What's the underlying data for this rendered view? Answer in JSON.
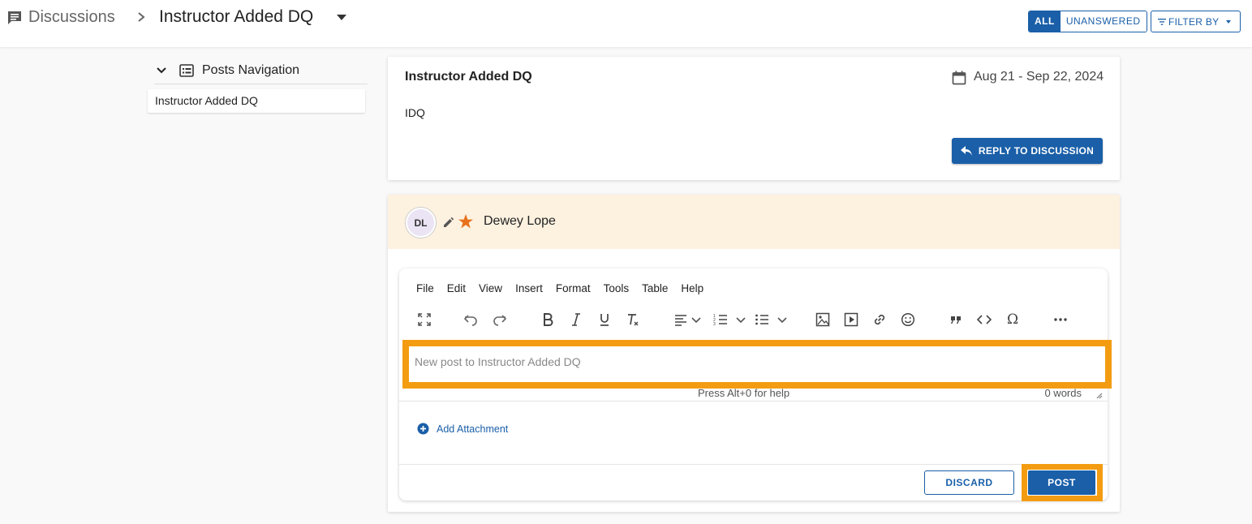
{
  "colors": {
    "primary": "#1a5fa8",
    "highlight": "#f39c12",
    "author_header_bg": "#fdf1e0",
    "star": "#e8711b"
  },
  "header": {
    "icon": "chat-bubble-icon",
    "root_label": "Discussions",
    "current_label": "Instructor Added DQ",
    "filter_all": "ALL",
    "filter_unanswered": "UNANSWERED",
    "filter_by": "FILTER BY"
  },
  "nav": {
    "title": "Posts Navigation",
    "items": [
      {
        "label": "Instructor Added DQ"
      }
    ]
  },
  "topic": {
    "title": "Instructor Added DQ",
    "dates": "Aug 21 - Sep 22, 2024",
    "body": "IDQ",
    "reply_label": "REPLY TO DISCUSSION"
  },
  "reply": {
    "initials": "DL",
    "author": "Dewey Lope",
    "editor": {
      "menu": [
        "File",
        "Edit",
        "View",
        "Insert",
        "Format",
        "Tools",
        "Table",
        "Help"
      ],
      "placeholder": "New post to Instructor Added DQ",
      "help_hint": "Press Alt+0 for help",
      "word_count": "0 words",
      "toolbar_icons": [
        "fullscreen-icon",
        "undo-icon",
        "redo-icon",
        "bold-icon",
        "italic-icon",
        "underline-icon",
        "clear-format-icon",
        "align-icon",
        "numbered-list-icon",
        "bullet-list-icon",
        "image-icon",
        "media-icon",
        "link-icon",
        "emoji-icon",
        "blockquote-icon",
        "code-icon",
        "special-char-icon",
        "more-icon"
      ]
    },
    "add_attachment": "Add Attachment",
    "discard_label": "DISCARD",
    "post_label": "POST"
  }
}
